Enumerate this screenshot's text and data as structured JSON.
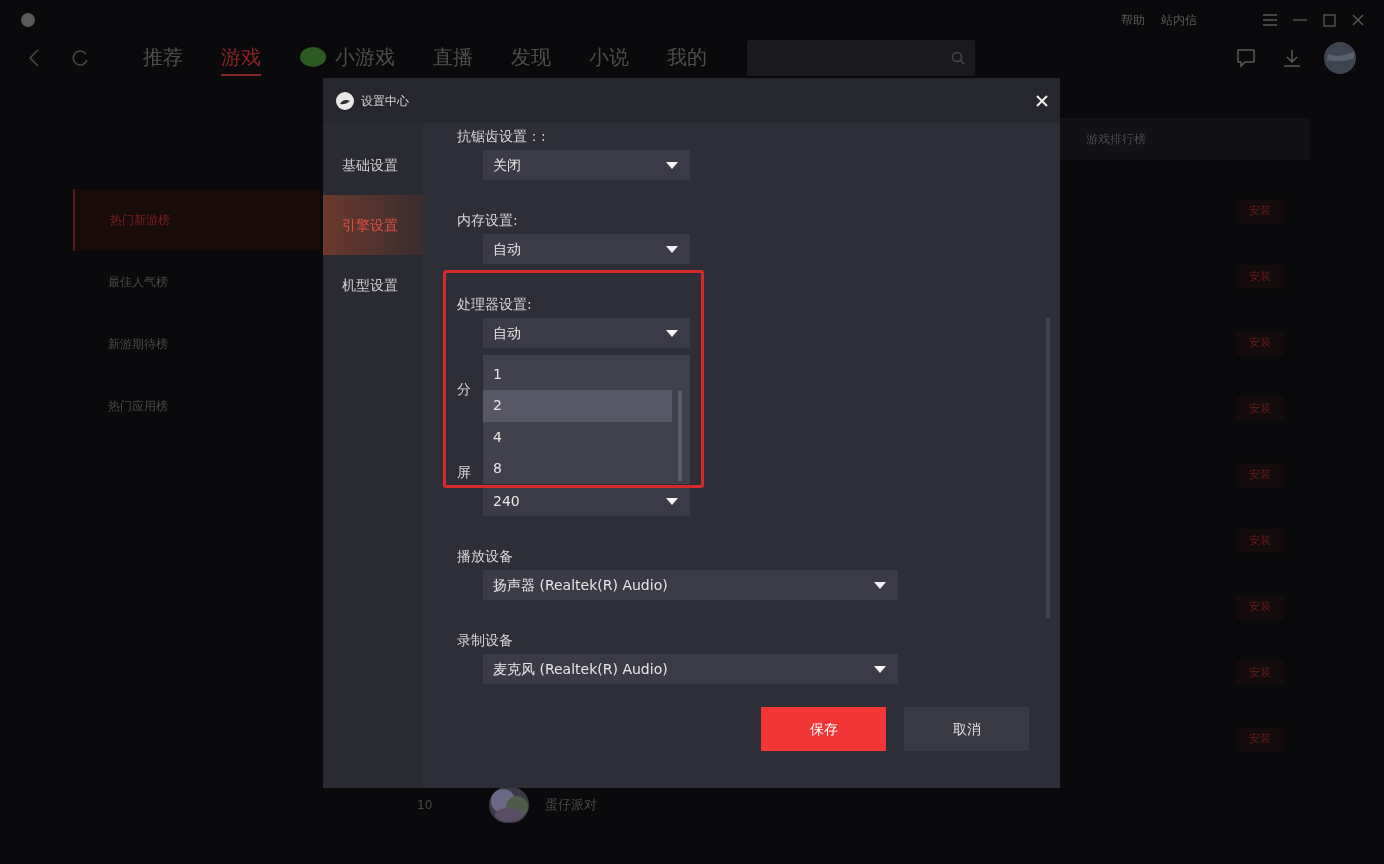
{
  "titlebar": {
    "links": [
      "帮助",
      "站内信"
    ]
  },
  "nav": {
    "tabs": [
      {
        "label": "推荐",
        "selected": false,
        "kind": "text"
      },
      {
        "label": "游戏",
        "selected": true,
        "kind": "text"
      },
      {
        "label": "小游戏",
        "selected": false,
        "kind": "leaf"
      },
      {
        "label": "直播",
        "selected": false,
        "kind": "text"
      },
      {
        "label": "发现",
        "selected": false,
        "kind": "text"
      },
      {
        "label": "小说",
        "selected": false,
        "kind": "text"
      },
      {
        "label": "我的",
        "selected": false,
        "kind": "text"
      }
    ]
  },
  "sidebar": {
    "items": [
      {
        "label": "热门新游榜",
        "selected": true
      },
      {
        "label": "最佳人气榜",
        "selected": false
      },
      {
        "label": "新游期待榜",
        "selected": false
      },
      {
        "label": "热门应用榜",
        "selected": false
      }
    ]
  },
  "ranking": {
    "title": "游戏排行榜",
    "rows": [
      {
        "action": "安装"
      },
      {
        "action": "安装"
      },
      {
        "action": "安装"
      },
      {
        "action": "安装"
      },
      {
        "action": "安装"
      },
      {
        "action": "安装"
      },
      {
        "action": "安装"
      },
      {
        "action": "安装"
      },
      {
        "action": "安装"
      },
      {
        "rank": "10",
        "name": "蛋仔派对",
        "kind": "picture"
      }
    ]
  },
  "dialog": {
    "title": "设置中心",
    "tabs": [
      {
        "label": "基础设置",
        "selected": false
      },
      {
        "label": "引擎设置",
        "selected": true
      },
      {
        "label": "机型设置",
        "selected": false
      }
    ],
    "settings": [
      {
        "label": "抗锯齿设置：:",
        "value": "关闭",
        "kind": "short_select"
      },
      {
        "label": "内存设置:",
        "value": "自动",
        "kind": "short_select"
      },
      {
        "label": "处理器设置:",
        "value": "自动",
        "kind": "short_select",
        "annotated": true,
        "options": [
          {
            "label": "1",
            "selected": false
          },
          {
            "label": "2",
            "selected": true
          },
          {
            "label": "4",
            "selected": false
          },
          {
            "label": "8",
            "selected": false
          }
        ]
      },
      {
        "label": "分",
        "kind": "covered"
      },
      {
        "label": "屏",
        "value": "240",
        "kind": "short_select"
      },
      {
        "label": "播放设备",
        "value": "扬声器 (Realtek(R) Audio)",
        "kind": "wide_select"
      },
      {
        "label": "录制设备",
        "value": "麦克风 (Realtek(R) Audio)",
        "kind": "wide_select"
      }
    ],
    "buttons": [
      {
        "label": "保存",
        "kind": "primary"
      },
      {
        "label": "取消",
        "kind": "secondary"
      }
    ]
  }
}
